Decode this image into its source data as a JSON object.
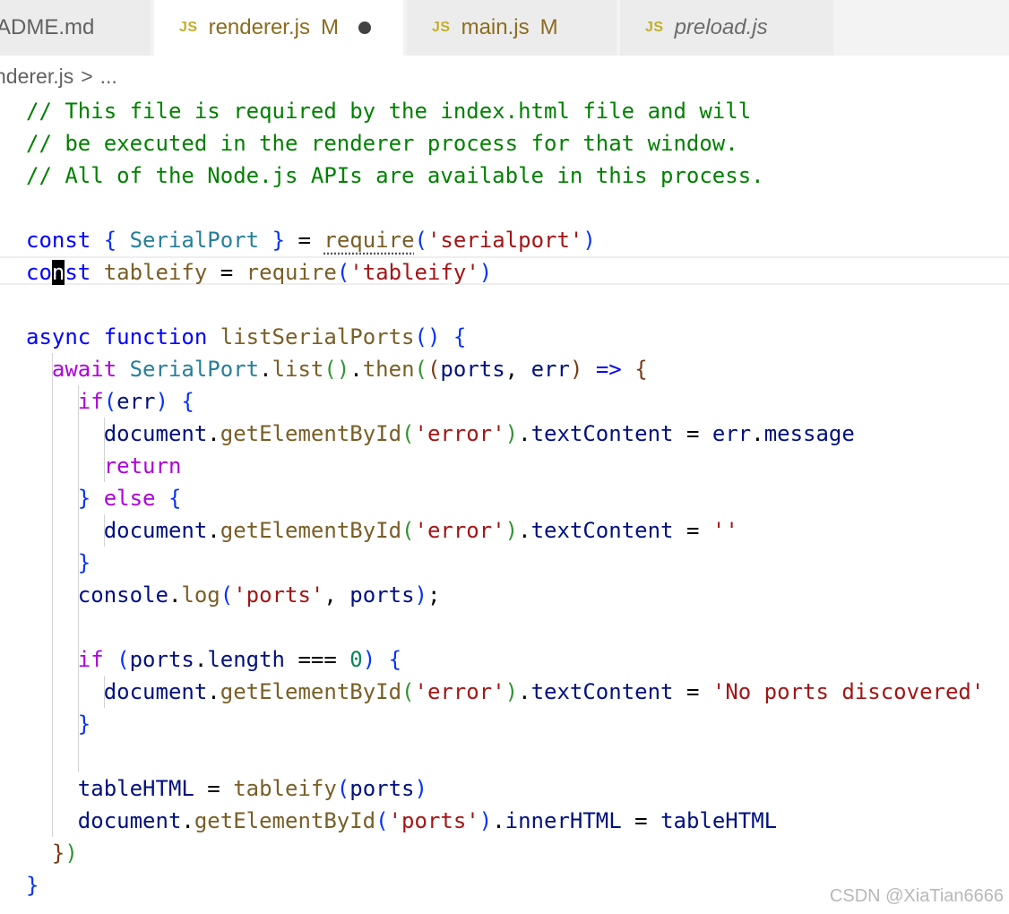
{
  "tabs": [
    {
      "label": "ADME.md",
      "modified": "",
      "dirty": false
    },
    {
      "label": "renderer.js",
      "modified": "M",
      "dirty": true,
      "icon": "JS"
    },
    {
      "label": "main.js",
      "modified": "M",
      "dirty": false,
      "icon": "JS"
    },
    {
      "label": "preload.js",
      "modified": "",
      "dirty": false,
      "icon": "JS"
    }
  ],
  "breadcrumb": {
    "file": "nderer.js",
    "separator": ">",
    "more": "..."
  },
  "code": {
    "l1": "// This file is required by the index.html file and will",
    "l2": "// be executed in the renderer process for that window.",
    "l3": "// All of the Node.js APIs are available in this process.",
    "l5_const": "const",
    "l5_lbrace": "{",
    "l5_class": "SerialPort",
    "l5_rbrace": "}",
    "l5_eq": "=",
    "l5_require": "require",
    "l5_lp": "(",
    "l5_str": "'serialport'",
    "l5_rp": ")",
    "l6_co": "co",
    "l6_n": "n",
    "l6_st": "st",
    "l6_var": "tableify",
    "l6_eq": "=",
    "l6_require": "require",
    "l6_lp": "(",
    "l6_str": "'tableify'",
    "l6_rp": ")",
    "l8_async": "async",
    "l8_function": "function",
    "l8_name": "listSerialPorts",
    "l8_parens": "()",
    "l8_brace": "{",
    "l9_await": "await",
    "l9_class": "SerialPort",
    "l9_dot": ".",
    "l9_list": "list",
    "l9_lp": "(",
    "l9_rp": ")",
    "l9_dot2": ".",
    "l9_then": "then",
    "l9_lp2": "(",
    "l9_lp3": "(",
    "l9_ports": "ports",
    "l9_comma": ",",
    "l9_err": "err",
    "l9_rp3": ")",
    "l9_arrow": "=>",
    "l9_brace": "{",
    "l10_if": "if",
    "l10_lp": "(",
    "l10_err": "err",
    "l10_rp": ")",
    "l10_brace": "{",
    "l11_doc": "document",
    "l11_dot": ".",
    "l11_fn": "getElementById",
    "l11_lp": "(",
    "l11_str": "'error'",
    "l11_rp": ")",
    "l11_dot2": ".",
    "l11_prop": "textContent",
    "l11_eq": "=",
    "l11_err": "err",
    "l11_dot3": ".",
    "l11_msg": "message",
    "l12_return": "return",
    "l13_rbrace": "}",
    "l13_else": "else",
    "l13_lbrace": "{",
    "l14_doc": "document",
    "l14_dot": ".",
    "l14_fn": "getElementById",
    "l14_lp": "(",
    "l14_str": "'error'",
    "l14_rp": ")",
    "l14_dot2": ".",
    "l14_prop": "textContent",
    "l14_eq": "=",
    "l14_str2": "''",
    "l15_rbrace": "}",
    "l16_console": "console",
    "l16_dot": ".",
    "l16_log": "log",
    "l16_lp": "(",
    "l16_str": "'ports'",
    "l16_comma": ",",
    "l16_ports": "ports",
    "l16_rp": ")",
    "l16_semi": ";",
    "l18_if": "if",
    "l18_lp": "(",
    "l18_ports": "ports",
    "l18_dot": ".",
    "l18_length": "length",
    "l18_eq": "===",
    "l18_zero": "0",
    "l18_rp": ")",
    "l18_brace": "{",
    "l19_doc": "document",
    "l19_dot": ".",
    "l19_fn": "getElementById",
    "l19_lp": "(",
    "l19_str": "'error'",
    "l19_rp": ")",
    "l19_dot2": ".",
    "l19_prop": "textContent",
    "l19_eq": "=",
    "l19_str2": "'No ports discovered'",
    "l20_rbrace": "}",
    "l22_var": "tableHTML",
    "l22_eq": "=",
    "l22_fn": "tableify",
    "l22_lp": "(",
    "l22_ports": "ports",
    "l22_rp": ")",
    "l23_doc": "document",
    "l23_dot": ".",
    "l23_fn": "getElementById",
    "l23_lp": "(",
    "l23_str": "'ports'",
    "l23_rp": ")",
    "l23_dot2": ".",
    "l23_prop": "innerHTML",
    "l23_eq": "=",
    "l23_var": "tableHTML",
    "l24_rbrace": "}",
    "l24_rp": ")",
    "l25_rbrace": "}"
  },
  "watermark": "CSDN @XiaTian6666",
  "colors": {
    "comment": "#008000",
    "keyword": "#0000ff",
    "control": "#af00db",
    "class": "#267f99",
    "function": "#795e26",
    "string": "#a31515",
    "variable": "#001080",
    "number": "#098658"
  }
}
